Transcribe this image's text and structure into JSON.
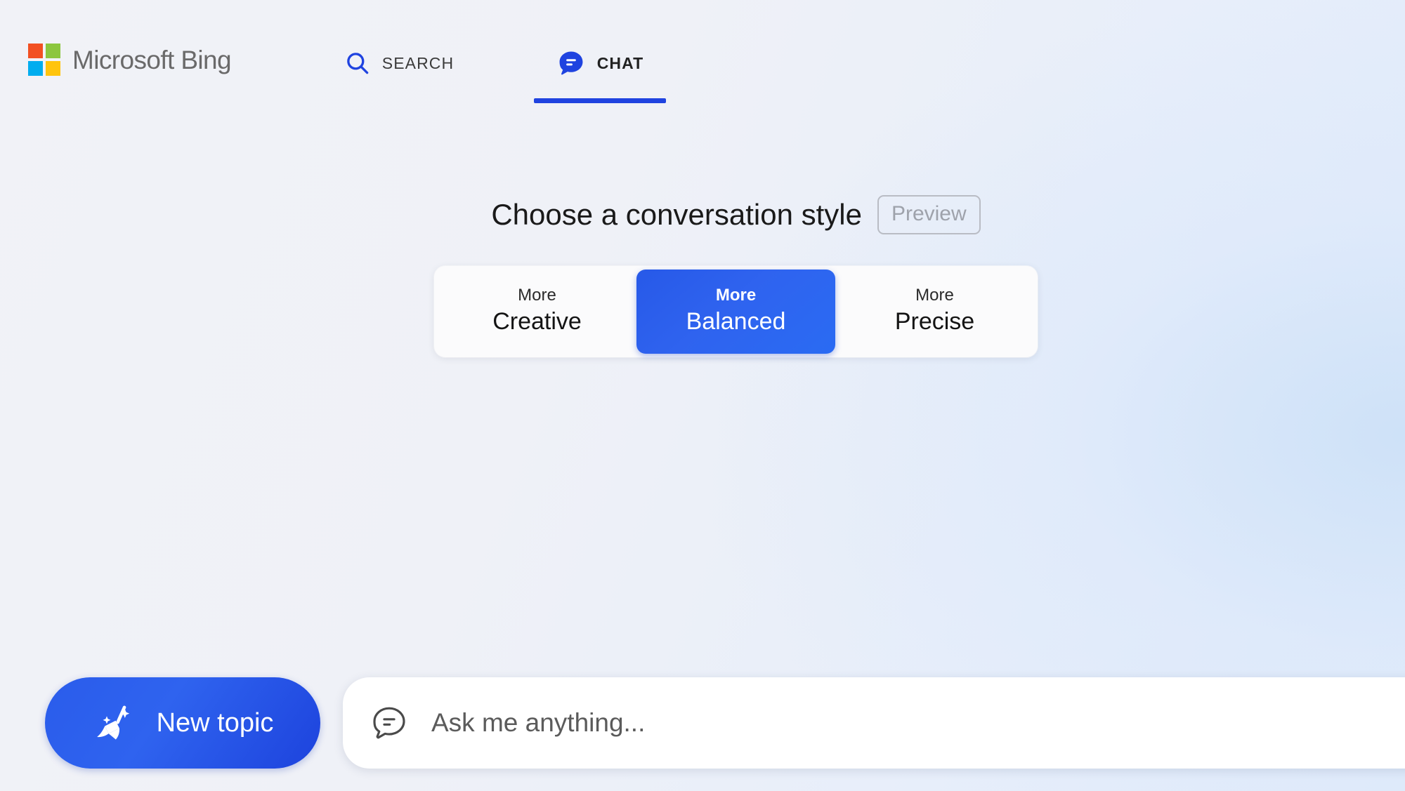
{
  "brand": {
    "name": "Microsoft Bing",
    "logo_colors": {
      "top_left": "#f25022",
      "top_right": "#8cc63e",
      "bottom_left": "#00adef",
      "bottom_right": "#ffc40d"
    }
  },
  "nav": {
    "tabs": [
      {
        "label": "SEARCH",
        "icon": "search-icon",
        "active": false
      },
      {
        "label": "CHAT",
        "icon": "chat-bubble-icon",
        "active": true
      }
    ],
    "accent_color": "#1f43e0"
  },
  "style_selector": {
    "heading": "Choose a conversation style",
    "preview_badge": "Preview",
    "selected": "Balanced",
    "options": [
      {
        "prefix": "More",
        "name": "Creative",
        "selected": false
      },
      {
        "prefix": "More",
        "name": "Balanced",
        "selected": true
      },
      {
        "prefix": "More",
        "name": "Precise",
        "selected": false
      }
    ],
    "selected_color": "#2f63ef"
  },
  "composer": {
    "new_topic_label": "New topic",
    "new_topic_icon": "broom-sparkle-icon",
    "input_icon": "chat-bubble-outline-icon",
    "input_value": "",
    "input_placeholder": "Ask me anything...",
    "button_color": "#2f63ef"
  }
}
